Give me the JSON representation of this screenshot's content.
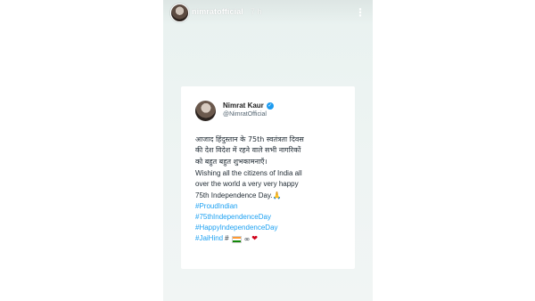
{
  "story": {
    "username": "nimratofficial",
    "time": "7 h",
    "menu_icon": "more-vertical-icon"
  },
  "tweet": {
    "name": "Nimrat Kaur",
    "handle": "@NimratOfficial",
    "verified_icon": "verified-badge-icon",
    "hindi_text": "आजाद हिंदुस्तान के 75th स्वतंत्रता दिवस\nकी देश विदेश में रहने वाले सभी नागरिकों\nको बहुत बहुत शुभकामनाएँ।",
    "english_text": "Wishing all the citizens of India all\nover the world a very very happy\n75th Independence Day.",
    "folded_hands": "🙏",
    "hashtags": [
      "#ProudIndian",
      "#75thIndependenceDay",
      "#HappyIndependenceDay",
      "#JaiHind"
    ],
    "hash_symbol": "#",
    "infinity": "∞",
    "heart": "❤",
    "accent_color": "#1da1f2",
    "verified_color": "#1d9bf0"
  }
}
